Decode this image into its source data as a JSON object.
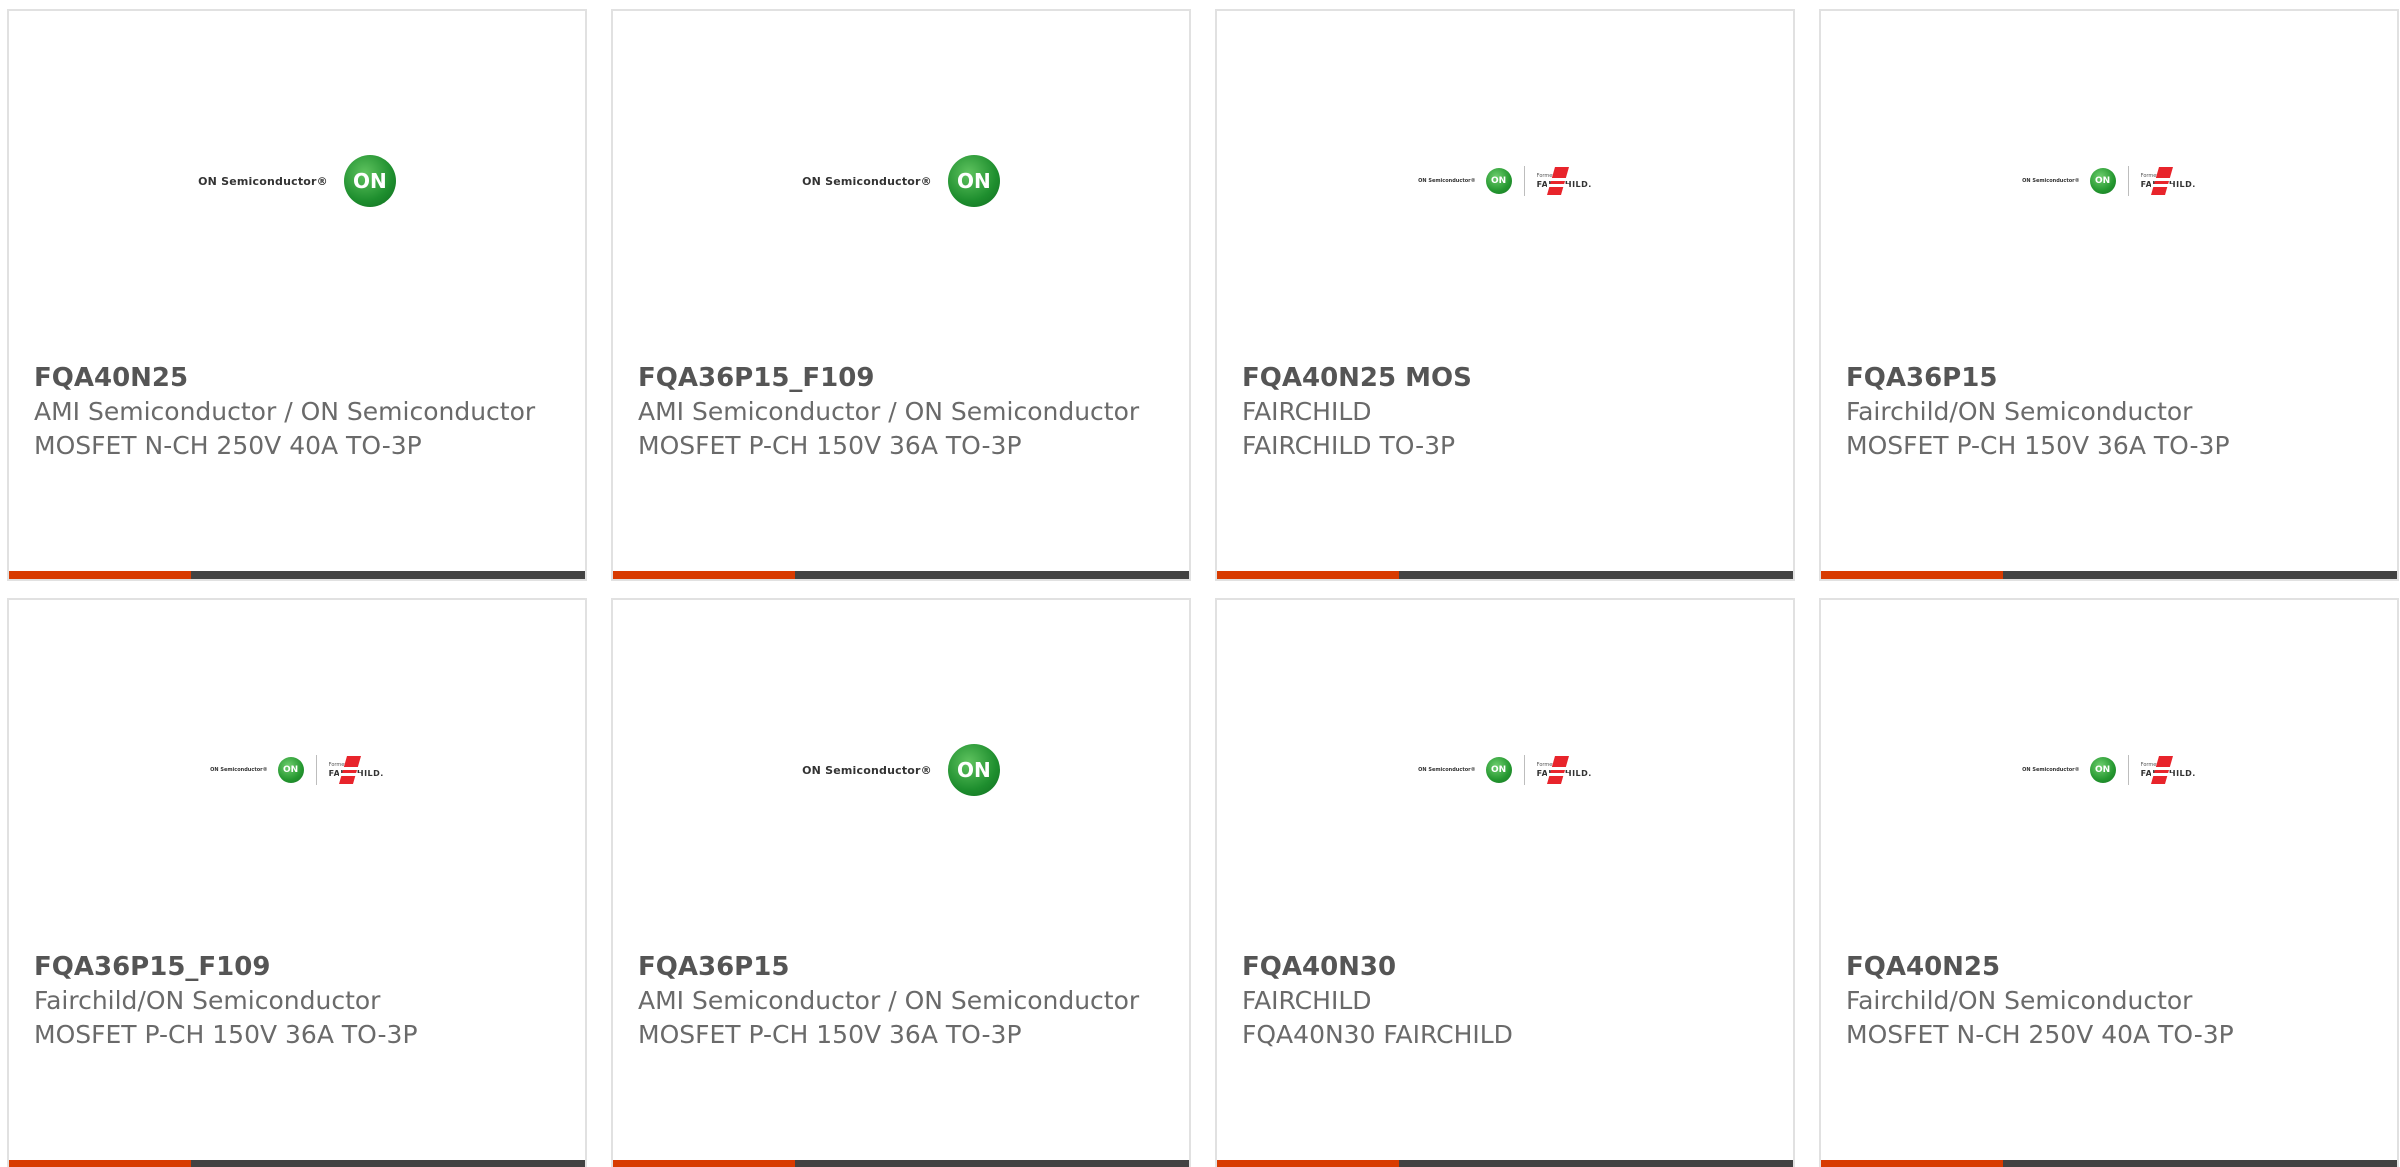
{
  "colors": {
    "accent": "#d83b01",
    "bar": "#424242",
    "on_green": "#1e8e2e",
    "fairchild_red": "#e8242b"
  },
  "logos": {
    "on": {
      "text": "ON Semiconductor®",
      "mark": "ON"
    },
    "combo": {
      "on_text": "ON Semiconductor®",
      "on_mark": "ON",
      "formerly": "Formerly",
      "fairchild": "FAIRCHILD."
    }
  },
  "products": [
    {
      "part": "FQA40N25",
      "maker": "AMI Semiconductor / ON Semiconductor",
      "desc": "MOSFET N-CH 250V 40A TO-3P",
      "logo": "on"
    },
    {
      "part": "FQA36P15_F109",
      "maker": "AMI Semiconductor / ON Semiconductor",
      "desc": "MOSFET P-CH 150V 36A TO-3P",
      "logo": "on"
    },
    {
      "part": "FQA40N25 MOS",
      "maker": "FAIRCHILD",
      "desc": "FAIRCHILD TO-3P",
      "logo": "combo"
    },
    {
      "part": "FQA36P15",
      "maker": "Fairchild/ON Semiconductor",
      "desc": "MOSFET P-CH 150V 36A TO-3P",
      "logo": "combo"
    },
    {
      "part": "FQA36P15_F109",
      "maker": "Fairchild/ON Semiconductor",
      "desc": "MOSFET P-CH 150V 36A TO-3P",
      "logo": "combo"
    },
    {
      "part": "FQA36P15",
      "maker": "AMI Semiconductor / ON Semiconductor",
      "desc": "MOSFET P-CH 150V 36A TO-3P",
      "logo": "on"
    },
    {
      "part": "FQA40N30",
      "maker": "FAIRCHILD",
      "desc": "FQA40N30 FAIRCHILD",
      "logo": "combo"
    },
    {
      "part": "FQA40N25",
      "maker": "Fairchild/ON Semiconductor",
      "desc": "MOSFET N-CH 250V 40A TO-3P",
      "logo": "combo"
    }
  ]
}
